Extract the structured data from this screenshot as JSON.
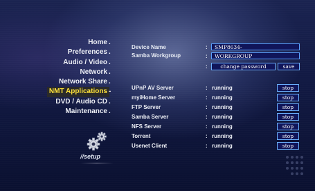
{
  "menu": {
    "items": [
      {
        "label": "Home",
        "dot": ".",
        "active": false
      },
      {
        "label": "Preferences",
        "dot": ".",
        "active": false
      },
      {
        "label": "Audio / Video",
        "dot": ".",
        "active": false
      },
      {
        "label": "Network",
        "dot": ".",
        "active": false
      },
      {
        "label": "Network Share",
        "dot": ".",
        "active": false
      },
      {
        "label": "NMT Applications",
        "dot": "-",
        "active": true
      },
      {
        "label": "DVD / Audio CD",
        "dot": ".",
        "active": false
      },
      {
        "label": "Maintenance",
        "dot": ".",
        "active": false
      }
    ]
  },
  "setup": {
    "label": "//setup",
    "icon": "gears-icon"
  },
  "settings": {
    "device_name_label": "Device Name",
    "device_name_value": "SMP8634-",
    "workgroup_label": "Samba Workgroup",
    "workgroup_value": "WORKGROUP",
    "colon": ":",
    "change_password_label": "change password",
    "save_label": "save"
  },
  "services": [
    {
      "name": "UPnP AV Server",
      "status": "running",
      "action": "stop"
    },
    {
      "name": "myiHome Server",
      "status": "running",
      "action": "stop"
    },
    {
      "name": "FTP Server",
      "status": "running",
      "action": "stop"
    },
    {
      "name": "Samba Server",
      "status": "running",
      "action": "stop"
    },
    {
      "name": "NFS Server",
      "status": "running",
      "action": "stop"
    },
    {
      "name": "Torrent",
      "status": "running",
      "action": "stop"
    },
    {
      "name": "Usenet Client",
      "status": "running",
      "action": "stop"
    }
  ],
  "colors": {
    "active_menu": "#ffe23a",
    "button_border": "#6aaefc",
    "button_fill": "#10155a"
  }
}
